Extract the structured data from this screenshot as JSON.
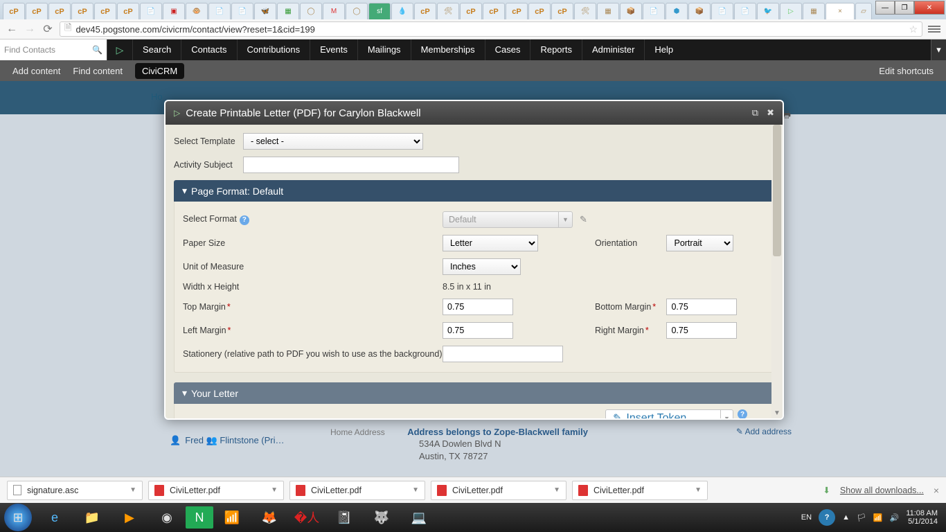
{
  "browser": {
    "url": "dev45.pogstone.com/civicrm/contact/view?reset=1&cid=199",
    "tabs_cp": "cP"
  },
  "civnav": {
    "find_placeholder": "Find Contacts",
    "items": [
      "Search",
      "Contacts",
      "Contributions",
      "Events",
      "Mailings",
      "Memberships",
      "Cases",
      "Reports",
      "Administer",
      "Help"
    ]
  },
  "shortcuts": {
    "add": "Add content",
    "find": "Find content",
    "civi": "CiviCRM",
    "edit": "Edit shortcuts"
  },
  "peek_home": "Ho",
  "modal": {
    "title": "Create Printable Letter (PDF) for Carylon Blackwell",
    "select_template_label": "Select Template",
    "select_template_value": "- select -",
    "activity_subject_label": "Activity Subject",
    "pf_header": "Page Format: Default",
    "select_format_label": "Select Format",
    "select_format_value": "Default",
    "paper_size_label": "Paper Size",
    "paper_size_value": "Letter",
    "orientation_label": "Orientation",
    "orientation_value": "Portrait",
    "unit_label": "Unit of Measure",
    "unit_value": "Inches",
    "wh_label": "Width x Height",
    "wh_value": "8.5 in x 11 in",
    "top_margin_label": "Top Margin",
    "bottom_margin_label": "Bottom Margin",
    "left_margin_label": "Left Margin",
    "right_margin_label": "Right Margin",
    "margin_value": "0.75",
    "stationery_label": "Stationery (relative path to PDF you wish to use as the background)",
    "your_letter": "Your Letter",
    "insert_token": "Insert Token"
  },
  "behind": {
    "fred": "Fred 👥 Flintstone (Pri…",
    "home_addr_label": "Home Address",
    "belongs": "Address belongs to ",
    "belongs_link": "Zope-Blackwell family",
    "line1": "534A Dowlen Blvd N",
    "line2": "Austin, TX 78727",
    "add_addr": "Add address"
  },
  "downloads": {
    "sig": "signature.asc",
    "civi": "CiviLetter.pdf",
    "showall": "Show all downloads..."
  },
  "taskbar": {
    "lang": "EN",
    "time": "11:08 AM",
    "date": "5/1/2014"
  }
}
